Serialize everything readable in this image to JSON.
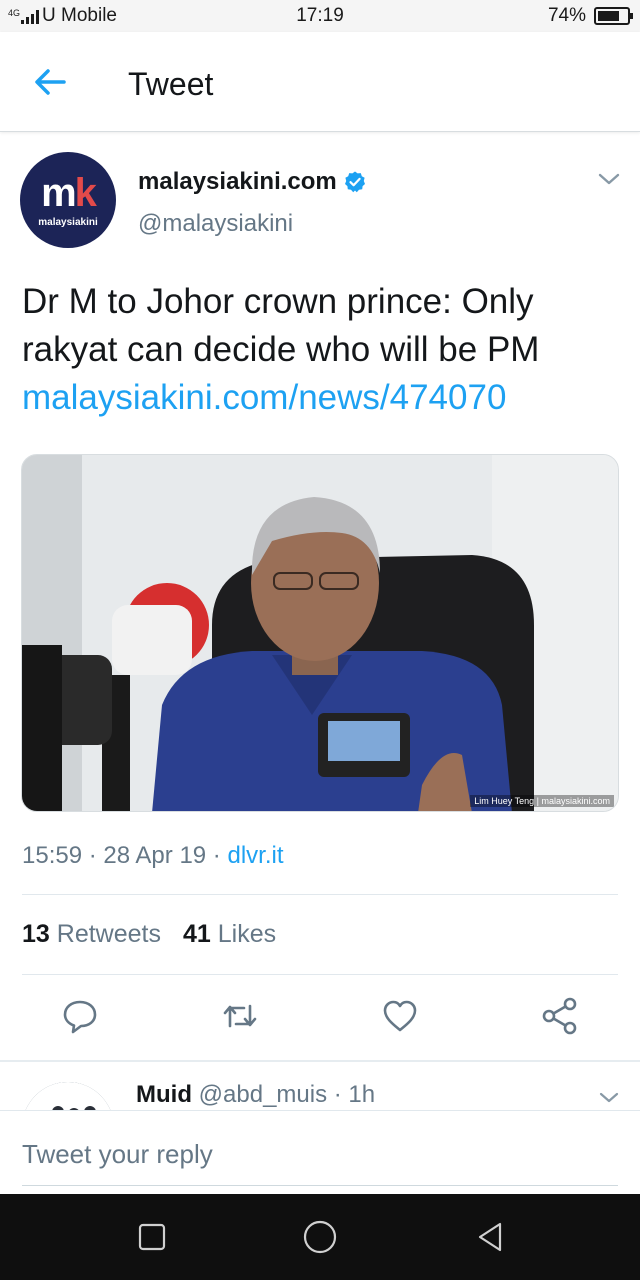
{
  "status_bar": {
    "network_tag": "4G",
    "carrier": "U Mobile",
    "time": "17:19",
    "battery_text": "74%",
    "battery_level": 0.74
  },
  "header": {
    "title": "Tweet",
    "back_icon": "back-arrow-icon"
  },
  "tweet": {
    "display_name": "malaysiakini.com",
    "handle": "@malaysiakini",
    "avatar_label": "malaysiakini",
    "text": "Dr M to Johor crown prince: Only rakyat can decide who will be PM",
    "link": "malaysiakini.com/news/474070",
    "photo_credit": "Lim Huey Teng | malaysiakini.com",
    "timestamp": "15:59 · 28 Apr 19 · ",
    "source": "dlvr.it",
    "retweets_count": "13",
    "retweets_label": "Retweets",
    "likes_count": "41",
    "likes_label": "Likes"
  },
  "actions": [
    "reply-icon",
    "retweet-icon",
    "like-icon",
    "share-icon"
  ],
  "reply": {
    "name": "Muid",
    "handle_time": "@abd_muis · 1h"
  },
  "compose": {
    "placeholder": "Tweet your reply"
  },
  "colors": {
    "accent": "#1da1f2",
    "text": "#14171a",
    "secondary": "#657786",
    "avatar_bg": "#1c2457"
  }
}
